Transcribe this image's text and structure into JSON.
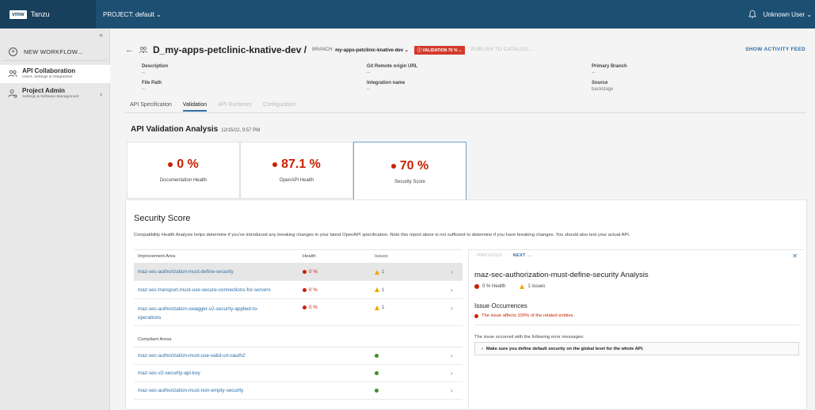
{
  "header": {
    "logo": "vmw",
    "app_name": "Tanzu",
    "project_label": "PROJECT: default ⌄",
    "user": "Unknown User ⌄"
  },
  "sidebar": {
    "collapse": "«",
    "new_workflow": "NEW WORKFLOW...",
    "items": [
      {
        "title": "API Collaboration",
        "subtitle": "Users, Settings & Integrations"
      },
      {
        "title": "Project Admin",
        "subtitle": "Settings & Software Management"
      }
    ]
  },
  "project": {
    "back": "←",
    "title": "D_my-apps-petclinic-knative-dev /",
    "branch_label": "BRANCH:",
    "branch_value": "my-apps-petclinic-knative-dev ⌄",
    "validation_badge": "ⓘ VALIDATION 70 % ⌄",
    "publish": "PUBLISH TO CATALOG...",
    "activity": "SHOW ACTIVITY FEED"
  },
  "meta": {
    "description_label": "Description",
    "description_value": "--",
    "file_path_label": "File Path",
    "file_path_value": "--",
    "git_label": "Git Remote origin URL",
    "git_value": "--",
    "integration_label": "Integration name",
    "integration_value": "--",
    "primary_branch_label": "Primary Branch",
    "primary_branch_value": "--",
    "source_label": "Source",
    "source_value": "backstage"
  },
  "tabs": [
    "API Specification",
    "Validation",
    "API Runtimes",
    "Configuration"
  ],
  "analysis": {
    "title": "API Validation Analysis",
    "timestamp": "12/15/22, 9:57 PM",
    "cards": [
      {
        "value": "0 %",
        "label": "Documentation Health"
      },
      {
        "value": "87.1 %",
        "label": "OpenAPI Health"
      },
      {
        "value": "70 %",
        "label": "Security Score"
      }
    ]
  },
  "security": {
    "title": "Security Score",
    "description": "Compatibility Health Analysis helps determine if you've introduced any breaking changes in your latest OpenAPI specification. Note this report alone is not sufficient to determine if you have breaking changes. You should also test your actual API.",
    "columns": [
      "Improvement Area",
      "Health",
      "Issues"
    ],
    "improvement_rows": [
      {
        "name": "maz-sec-authorization-must-define-security",
        "name2": "",
        "health": "0 %",
        "issues": "1"
      },
      {
        "name": "maz-sec-transport-must-use-secure-connections-for-servers",
        "name2": "",
        "health": "0 %",
        "issues": "1"
      },
      {
        "name": "maz-sec-authorization-swagger-v2-security-applied-to-",
        "name2": "operations",
        "health": "0 %",
        "issues": "1"
      }
    ],
    "compliant_label": "Compliant Areas",
    "compliant_rows": [
      {
        "name": "maz-sec-authorization-must-use-valid-url-oauth2"
      },
      {
        "name": "maz-sec-v2-security-api-key"
      },
      {
        "name": "maz-sec-authorization-must-non-empty-security"
      }
    ],
    "chevron": "›"
  },
  "detail": {
    "previous": "‹ PREVIOUS",
    "next": "NEXT →",
    "close": "✕",
    "title": "maz-sec-authorization-must-define-security Analysis",
    "health": "0 % Health",
    "issues": "1 issues",
    "occurrences_title": "Issue Occurrences",
    "occurrences_desc": "The issue affects 100% of the related entities.",
    "error_intro": "The issue occurred with the following error messages:",
    "error_message": "Make sure you define default security on the global level for the whole API.",
    "error_chevron": "›"
  }
}
